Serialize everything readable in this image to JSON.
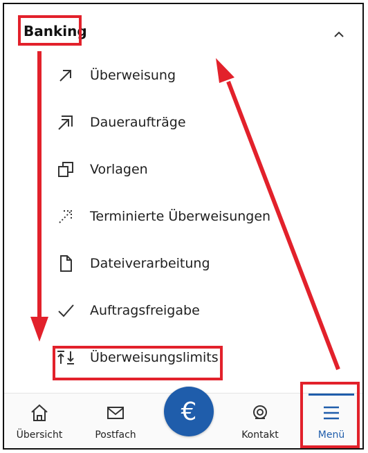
{
  "section": {
    "title": "Banking",
    "collapse_icon": "chevron-up-icon"
  },
  "menu_items": [
    {
      "label": "Überweisung",
      "icon": "arrow-up-right-icon"
    },
    {
      "label": "Daueraufträge",
      "icon": "double-arrow-up-right-icon"
    },
    {
      "label": "Vorlagen",
      "icon": "copy-icon"
    },
    {
      "label": "Terminierte Überweisungen",
      "icon": "dotted-arrow-icon"
    },
    {
      "label": "Dateiverarbeitung",
      "icon": "file-icon"
    },
    {
      "label": "Auftragsfreigabe",
      "icon": "checkmark-icon"
    },
    {
      "label": "Überweisungslimits",
      "icon": "transfer-limits-icon"
    }
  ],
  "bottom_nav": {
    "items": [
      {
        "label": "Übersicht",
        "icon": "home-icon"
      },
      {
        "label": "Postfach",
        "icon": "mail-icon"
      },
      {
        "label": "",
        "icon": "euro-icon",
        "symbol": "€"
      },
      {
        "label": "Kontakt",
        "icon": "headset-icon"
      },
      {
        "label": "Menü",
        "icon": "hamburger-menu-icon",
        "active": true
      }
    ]
  },
  "colors": {
    "accent": "#1f5dab",
    "annotation": "#e2212b",
    "text": "#1f1f1f"
  }
}
